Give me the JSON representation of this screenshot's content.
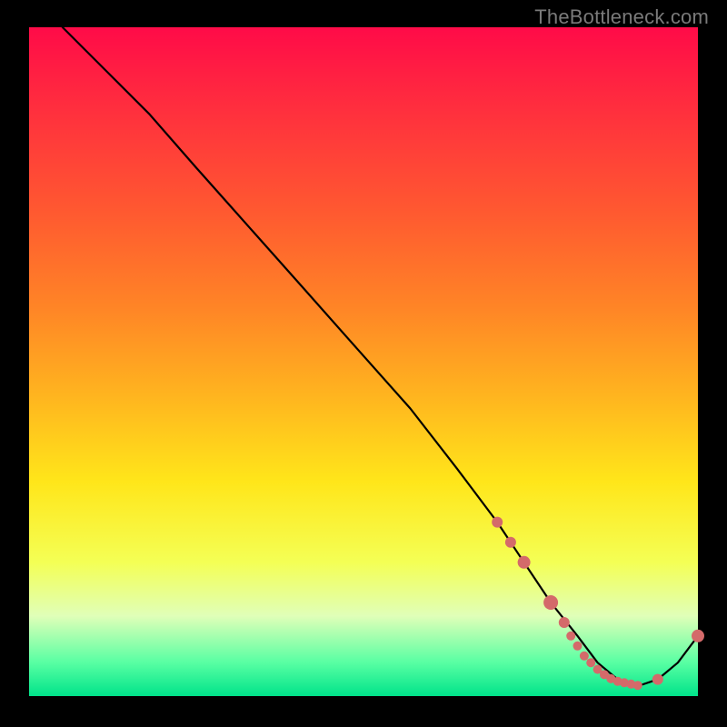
{
  "watermark": "TheBottleneck.com",
  "colors": {
    "marker": "#d46a6a",
    "curve": "#000000"
  },
  "chart_data": {
    "type": "line",
    "title": "",
    "xlabel": "",
    "ylabel": "",
    "xlim": [
      0,
      100
    ],
    "ylim": [
      0,
      100
    ],
    "grid": false,
    "legend_position": "none",
    "note": "Axes carry no numeric tick labels in the source image; values below are read in percent of the plot area (0–100 on each axis).",
    "series": [
      {
        "name": "curve",
        "kind": "line",
        "x": [
          5,
          8,
          12,
          18,
          25,
          33,
          41,
          49,
          57,
          64,
          70,
          74,
          78,
          82,
          85,
          88,
          91,
          94,
          97,
          100
        ],
        "y": [
          100,
          97,
          93,
          87,
          79,
          70,
          61,
          52,
          43,
          34,
          26,
          20,
          14,
          9,
          5,
          2.5,
          1.5,
          2.5,
          5,
          9
        ]
      },
      {
        "name": "markers",
        "kind": "scatter",
        "x": [
          70,
          72,
          74,
          78,
          80,
          81,
          82,
          83,
          84,
          85,
          86,
          87,
          88,
          89,
          90,
          91,
          94,
          100
        ],
        "y": [
          26,
          23,
          20,
          14,
          11,
          9,
          7.5,
          6,
          5,
          4,
          3.2,
          2.6,
          2.2,
          2,
          1.8,
          1.6,
          2.5,
          9
        ],
        "r": [
          6,
          6,
          7,
          8,
          6,
          5,
          5,
          5,
          5,
          5,
          5,
          5,
          5,
          5,
          5,
          5,
          6,
          7
        ]
      }
    ]
  }
}
